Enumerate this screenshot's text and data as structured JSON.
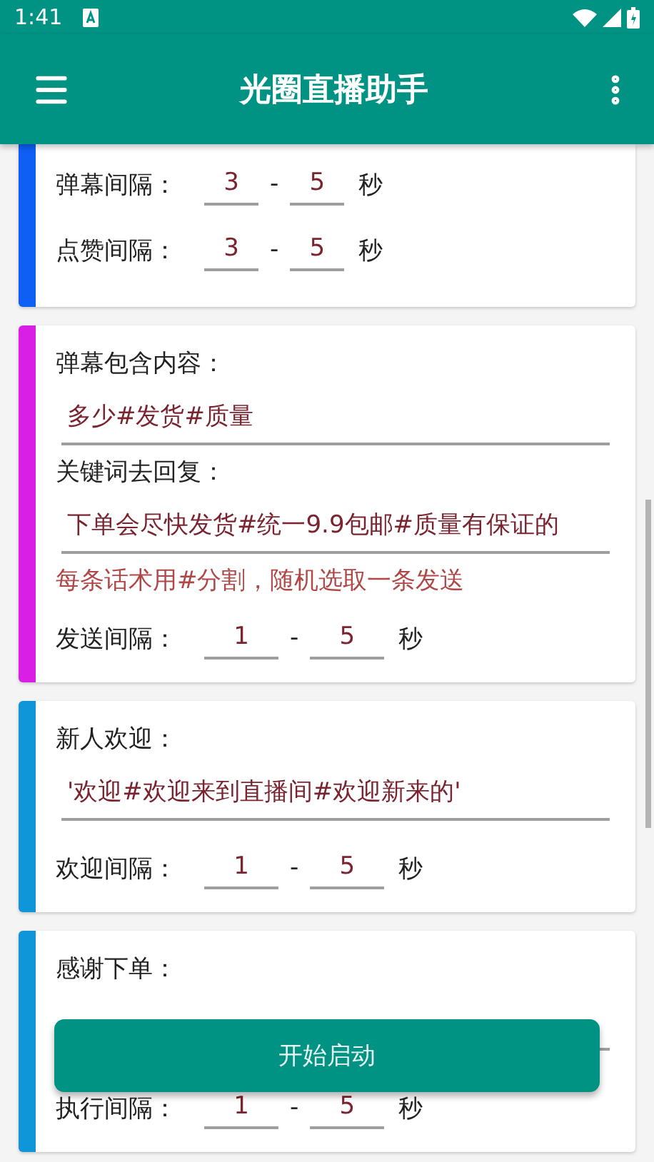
{
  "status_bar": {
    "time": "1:41"
  },
  "app_bar": {
    "title": "光圈直播助手"
  },
  "cards": [
    {
      "color": "#0f5ff5",
      "rows": [
        {
          "kind": "interval",
          "label": "弹幕间隔：",
          "min": "3",
          "separator": "-",
          "max": "5",
          "unit": "秒"
        },
        {
          "kind": "interval",
          "label": "点赞间隔：",
          "min": "3",
          "separator": "-",
          "max": "5",
          "unit": "秒"
        }
      ]
    },
    {
      "color": "#d81fe6",
      "rows": [
        {
          "kind": "label",
          "text": "弹幕包含内容："
        },
        {
          "kind": "field",
          "value": "多少#发货#质量"
        },
        {
          "kind": "label",
          "text": "关键词去回复："
        },
        {
          "kind": "field",
          "value": "下单会尽快发货#统一9.9包邮#质量有保证的"
        },
        {
          "kind": "hint",
          "text": "每条话术用#分割，随机选取一条发送"
        },
        {
          "kind": "interval",
          "label": "发送间隔：",
          "min": "1",
          "separator": "-",
          "max": "5",
          "unit": "秒"
        }
      ]
    },
    {
      "color": "#0f96d8",
      "rows": [
        {
          "kind": "label",
          "text": "新人欢迎："
        },
        {
          "kind": "field",
          "value": "'欢迎#欢迎来到直播间#欢迎新来的'"
        },
        {
          "kind": "interval",
          "label": "欢迎间隔：",
          "min": "1",
          "separator": "-",
          "max": "5",
          "unit": "秒"
        }
      ]
    },
    {
      "color": "#0f96d8",
      "rows": [
        {
          "kind": "label",
          "text": "感谢下单："
        },
        {
          "kind": "field"
        },
        {
          "kind": "interval",
          "label": "执行间隔：",
          "min": "1",
          "separator": "-",
          "max": "5",
          "unit": "秒"
        }
      ]
    }
  ],
  "floating_button": {
    "label": "开始启动"
  }
}
